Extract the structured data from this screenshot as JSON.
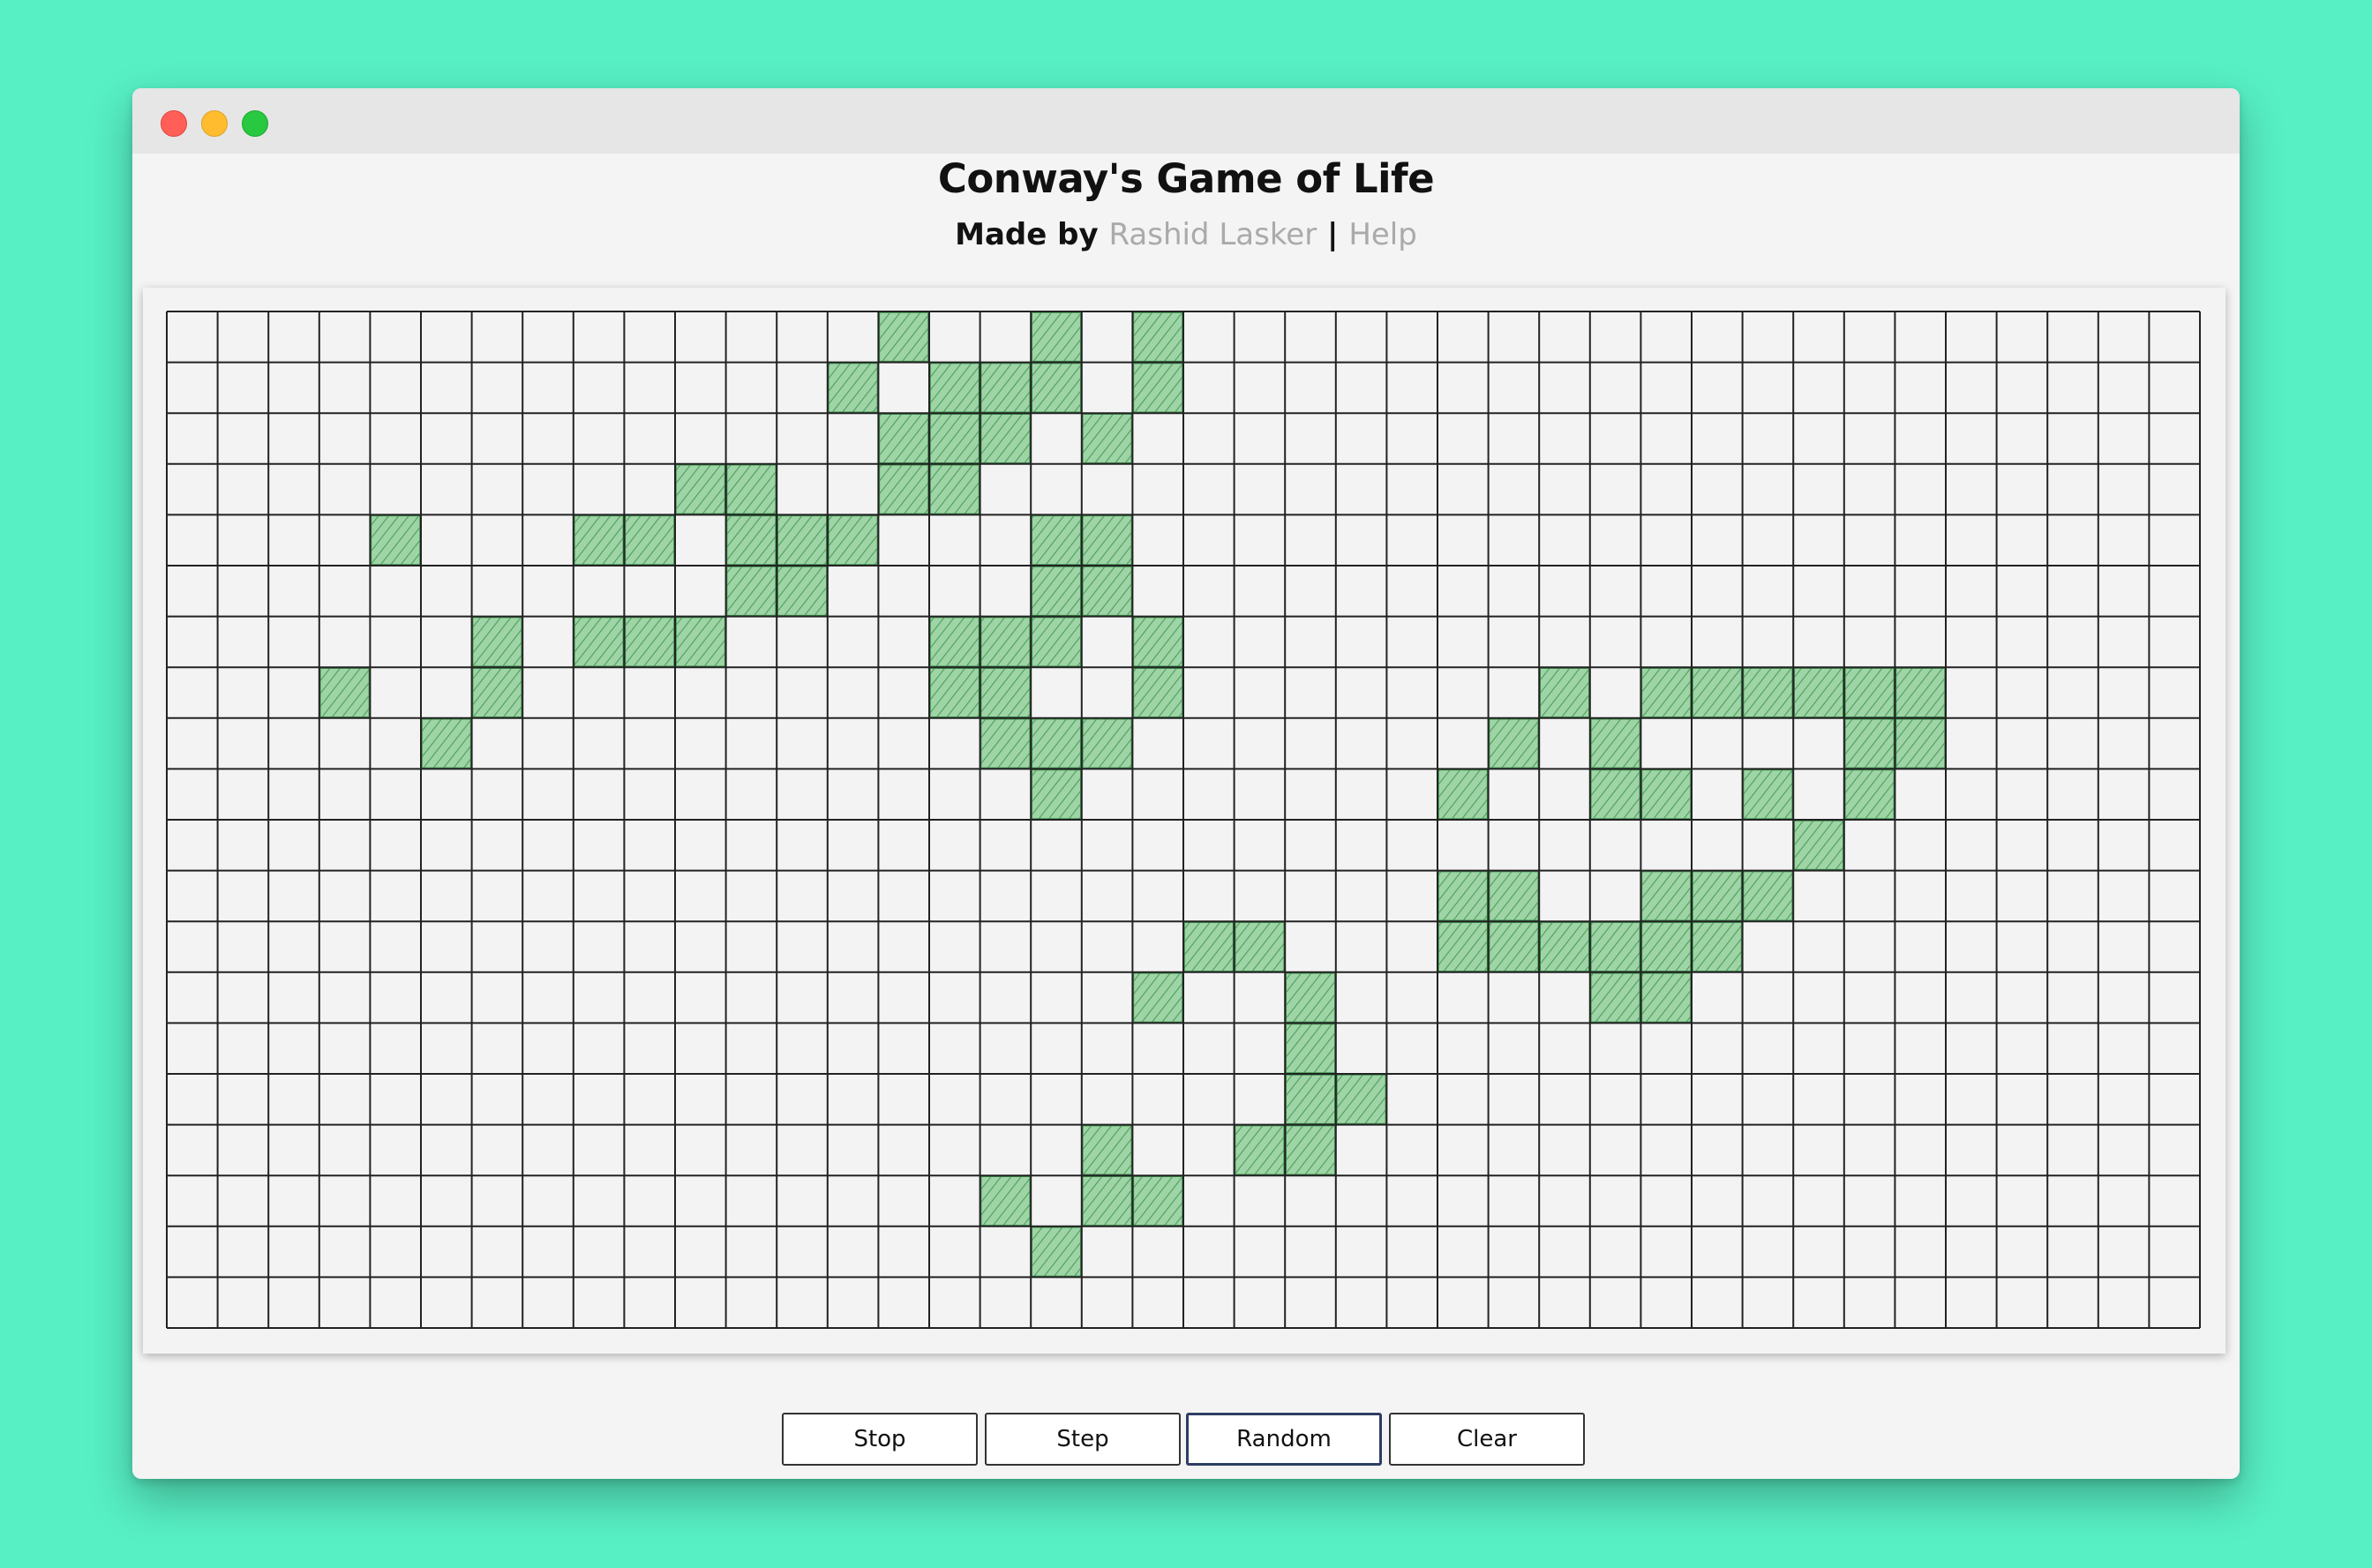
{
  "window": {
    "title": "Conway's Game of Life",
    "subtitle": {
      "prefix": "Made by",
      "author_link": "Rashid Lasker",
      "separator": "|",
      "help_link": "Help"
    }
  },
  "board": {
    "columns": 40,
    "rows": 20,
    "live_cell_color": "#6cbf7a",
    "grid_line_color": "#222222",
    "live_cells": [
      [
        14,
        0
      ],
      [
        17,
        0
      ],
      [
        19,
        0
      ],
      [
        13,
        1
      ],
      [
        15,
        1
      ],
      [
        16,
        1
      ],
      [
        17,
        1
      ],
      [
        19,
        1
      ],
      [
        14,
        2
      ],
      [
        15,
        2
      ],
      [
        16,
        2
      ],
      [
        18,
        2
      ],
      [
        10,
        3
      ],
      [
        11,
        3
      ],
      [
        14,
        3
      ],
      [
        15,
        3
      ],
      [
        4,
        4
      ],
      [
        8,
        4
      ],
      [
        9,
        4
      ],
      [
        11,
        4
      ],
      [
        12,
        4
      ],
      [
        13,
        4
      ],
      [
        17,
        4
      ],
      [
        18,
        4
      ],
      [
        11,
        5
      ],
      [
        12,
        5
      ],
      [
        17,
        5
      ],
      [
        18,
        5
      ],
      [
        6,
        6
      ],
      [
        8,
        6
      ],
      [
        9,
        6
      ],
      [
        10,
        6
      ],
      [
        15,
        6
      ],
      [
        16,
        6
      ],
      [
        17,
        6
      ],
      [
        19,
        6
      ],
      [
        3,
        7
      ],
      [
        6,
        7
      ],
      [
        15,
        7
      ],
      [
        16,
        7
      ],
      [
        19,
        7
      ],
      [
        27,
        7
      ],
      [
        29,
        7
      ],
      [
        30,
        7
      ],
      [
        31,
        7
      ],
      [
        32,
        7
      ],
      [
        33,
        7
      ],
      [
        34,
        7
      ],
      [
        5,
        8
      ],
      [
        16,
        8
      ],
      [
        17,
        8
      ],
      [
        18,
        8
      ],
      [
        26,
        8
      ],
      [
        28,
        8
      ],
      [
        33,
        8
      ],
      [
        34,
        8
      ],
      [
        17,
        9
      ],
      [
        25,
        9
      ],
      [
        28,
        9
      ],
      [
        29,
        9
      ],
      [
        31,
        9
      ],
      [
        33,
        9
      ],
      [
        32,
        10
      ],
      [
        25,
        11
      ],
      [
        26,
        11
      ],
      [
        29,
        11
      ],
      [
        30,
        11
      ],
      [
        31,
        11
      ],
      [
        20,
        12
      ],
      [
        21,
        12
      ],
      [
        25,
        12
      ],
      [
        26,
        12
      ],
      [
        27,
        12
      ],
      [
        28,
        12
      ],
      [
        29,
        12
      ],
      [
        30,
        12
      ],
      [
        19,
        13
      ],
      [
        22,
        13
      ],
      [
        28,
        13
      ],
      [
        29,
        13
      ],
      [
        22,
        14
      ],
      [
        22,
        15
      ],
      [
        23,
        15
      ],
      [
        18,
        16
      ],
      [
        21,
        16
      ],
      [
        22,
        16
      ],
      [
        16,
        17
      ],
      [
        18,
        17
      ],
      [
        19,
        17
      ],
      [
        17,
        18
      ]
    ]
  },
  "controls": {
    "stop_label": "Stop",
    "step_label": "Step",
    "random_label": "Random",
    "clear_label": "Clear"
  }
}
